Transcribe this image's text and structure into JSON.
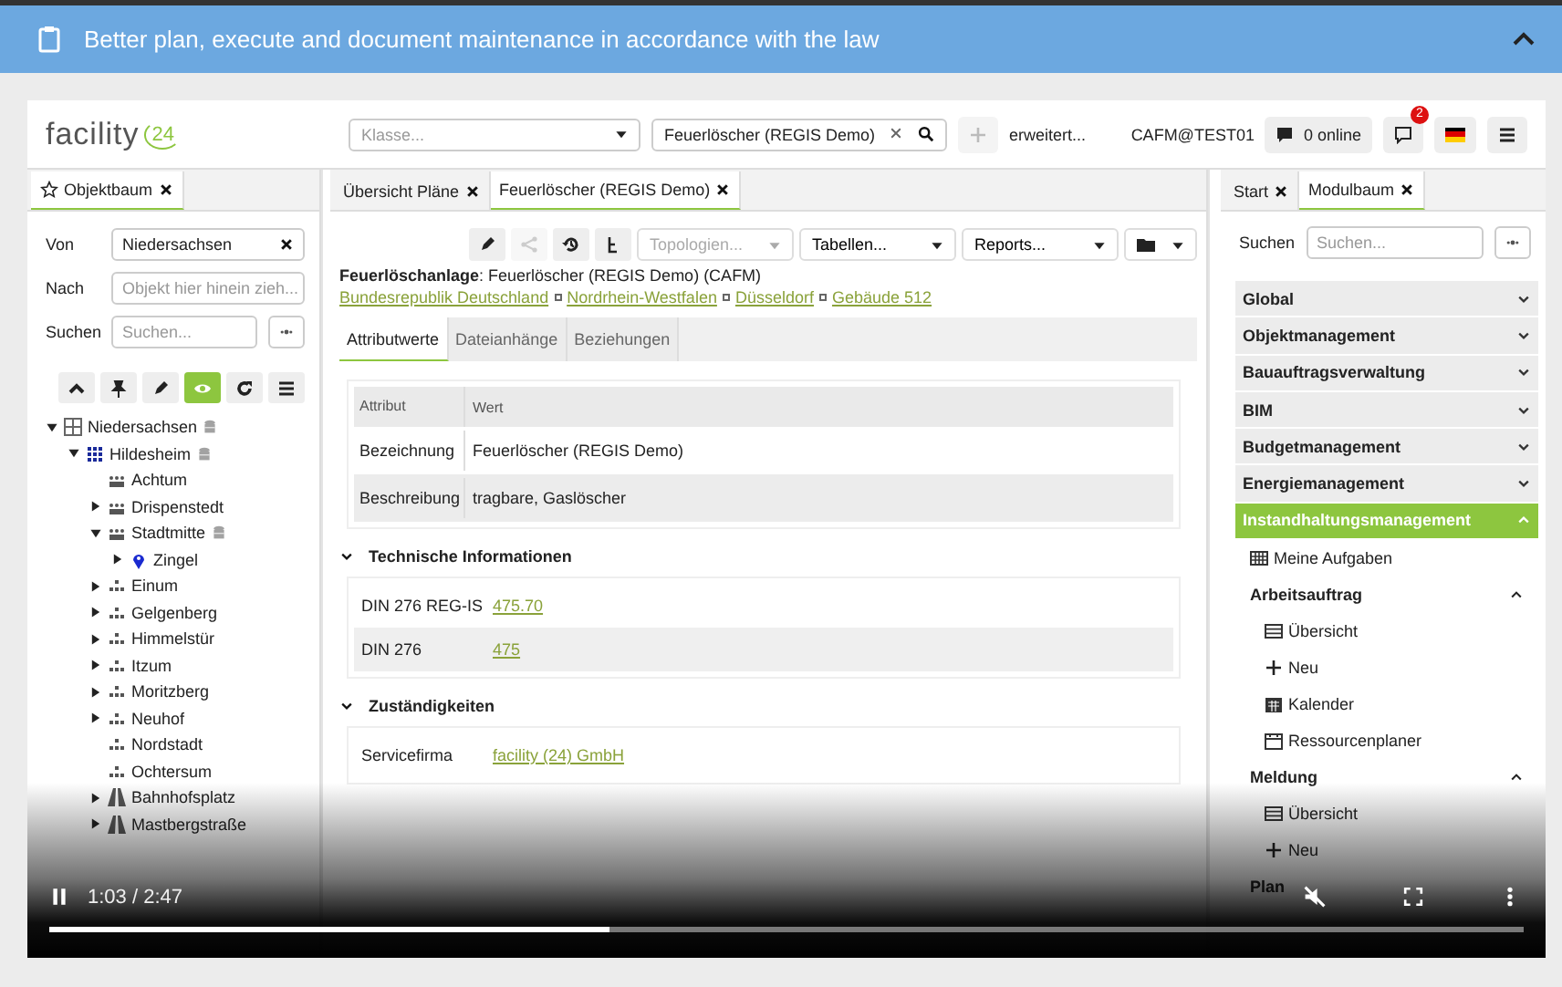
{
  "banner": {
    "title": "Better plan, execute and document maintenance in accordance with the law",
    "expanded": true
  },
  "header": {
    "logo_text": "facility",
    "logo_badge": "24",
    "class_select": {
      "placeholder": "Klasse..."
    },
    "search": {
      "value": "Feuerlöscher (REGIS Demo)"
    },
    "advanced_link": "erweitert...",
    "user": "CAFM@TEST01",
    "online": "0 online",
    "message_count": "2"
  },
  "left_panel": {
    "tabs": [
      {
        "label": "Objektbaum",
        "selected": true
      }
    ],
    "fields": [
      {
        "label": "Von",
        "value": "Niedersachsen"
      },
      {
        "label": "Nach",
        "placeholder": "Objekt hier hinein zieh..."
      },
      {
        "label": "Suchen",
        "placeholder": "Suchen..."
      }
    ],
    "tools": [
      {
        "selected": false
      },
      {
        "selected": false
      },
      {
        "selected": false
      },
      {
        "selected": true
      },
      {
        "selected": false
      },
      {
        "selected": false
      }
    ],
    "tree": [
      {
        "label": "Niedersachsen",
        "kind": "region",
        "expandable": true,
        "expanded": true,
        "stored": true,
        "children": [
          {
            "label": "Hildesheim",
            "kind": "city",
            "expandable": true,
            "expanded": true,
            "stored": true,
            "children": [
              {
                "label": "Achtum",
                "kind": "district",
                "expandable": false,
                "stored": false
              },
              {
                "label": "Drispenstedt",
                "kind": "district",
                "expandable": true,
                "expanded": false,
                "stored": false
              },
              {
                "label": "Stadtmitte",
                "kind": "district",
                "expandable": true,
                "expanded": true,
                "stored": true,
                "children": [
                  {
                    "label": "Zingel",
                    "kind": "location",
                    "expandable": true,
                    "expanded": false,
                    "stored": false
                  }
                ]
              },
              {
                "label": "Einum",
                "kind": "area",
                "expandable": true,
                "expanded": false,
                "stored": false
              },
              {
                "label": "Gelgenberg",
                "kind": "area",
                "expandable": true,
                "expanded": false,
                "stored": false
              },
              {
                "label": "Himmelstür",
                "kind": "area",
                "expandable": true,
                "expanded": false,
                "stored": false
              },
              {
                "label": "Itzum",
                "kind": "area",
                "expandable": true,
                "expanded": false,
                "stored": false
              },
              {
                "label": "Moritzberg",
                "kind": "area",
                "expandable": true,
                "expanded": false,
                "stored": false
              },
              {
                "label": "Neuhof",
                "kind": "area",
                "expandable": true,
                "expanded": false,
                "stored": false
              },
              {
                "label": "Nordstadt",
                "kind": "area",
                "expandable": false,
                "stored": false
              },
              {
                "label": "Ochtersum",
                "kind": "area",
                "expandable": false,
                "stored": false
              },
              {
                "label": "Bahnhofsplatz",
                "kind": "street",
                "expandable": true,
                "expanded": false,
                "stored": false
              },
              {
                "label": "Mastbergstraße",
                "kind": "street",
                "expandable": true,
                "expanded": false,
                "stored": false
              }
            ]
          }
        ]
      }
    ]
  },
  "center_panel": {
    "tabs": [
      {
        "label": "Übersicht Pläne",
        "selected": false
      },
      {
        "label": "Feuerlöscher (REGIS Demo)",
        "selected": true
      }
    ],
    "tools": [
      {
        "disabled": false
      },
      {
        "disabled": true
      },
      {
        "disabled": false
      },
      {
        "disabled": false
      }
    ],
    "dropdowns": [
      {
        "label": "Topologien...",
        "disabled": true
      },
      {
        "label": "Tabellen...",
        "disabled": false
      },
      {
        "label": "Reports...",
        "disabled": false
      }
    ],
    "heading": "**Feuerlöschanlage**: Feuerlöscher (REGIS Demo) (CAFM)",
    "breadcrumb": [
      "Bundesrepublik Deutschland",
      "Nordrhein-Westfalen",
      "Düsseldorf",
      "Gebäude 512"
    ],
    "detail_tabs": [
      {
        "label": "Attributwerte",
        "selected": true
      },
      {
        "label": "Dateianhänge",
        "selected": false
      },
      {
        "label": "Beziehungen",
        "selected": false
      }
    ],
    "table": {
      "columns": [
        "Attribut",
        "Wert"
      ],
      "rows": [
        [
          "Bezeichnung",
          "Feuerlöscher (REGIS Demo)"
        ],
        [
          "Beschreibung",
          "tragbare, Gaslöscher"
        ]
      ]
    },
    "sections": [
      {
        "title": "Technische Informationen",
        "expanded": true,
        "rows": [
          {
            "label": "DIN 276 REG-IS",
            "value": "475.70"
          },
          {
            "label": "DIN 276",
            "value": "475"
          }
        ]
      },
      {
        "title": "Zuständigkeiten",
        "expanded": true,
        "rows": [
          {
            "label": "Servicefirma",
            "value": "facility (24) GmbH"
          }
        ]
      }
    ]
  },
  "right_panel": {
    "tabs": [
      {
        "label": "Start",
        "selected": false
      },
      {
        "label": "Modulbaum",
        "selected": true
      }
    ],
    "search": {
      "label": "Suchen",
      "placeholder": "Suchen..."
    },
    "modules": [
      {
        "label": "Global",
        "expanded": false
      },
      {
        "label": "Objektmanagement",
        "expanded": false
      },
      {
        "label": "Bauauftragsverwaltung",
        "expanded": false
      },
      {
        "label": "BIM",
        "expanded": false
      },
      {
        "label": "Budgetmanagement",
        "expanded": false
      },
      {
        "label": "Energiemanagement",
        "expanded": false
      },
      {
        "label": "Instandhaltungsmanagement",
        "expanded": true,
        "children": [
          {
            "kind": "tasks",
            "label": "Meine Aufgaben"
          },
          {
            "kind": "group",
            "label": "Arbeitsauftrag",
            "expanded": true,
            "children": [
              {
                "kind": "overview",
                "label": "Übersicht"
              },
              {
                "kind": "new",
                "label": "Neu"
              },
              {
                "kind": "calendar",
                "label": "Kalender"
              },
              {
                "kind": "planner",
                "label": "Ressourcenplaner"
              }
            ]
          },
          {
            "kind": "group",
            "label": "Meldung",
            "expanded": true,
            "children": [
              {
                "kind": "overview",
                "label": "Übersicht"
              },
              {
                "kind": "new",
                "label": "Neu"
              }
            ]
          },
          {
            "kind": "group",
            "label": "Plan"
          }
        ]
      }
    ]
  },
  "player": {
    "playing": true,
    "time": "1:03 / 2:47",
    "muted": true,
    "level": 0.38
  }
}
